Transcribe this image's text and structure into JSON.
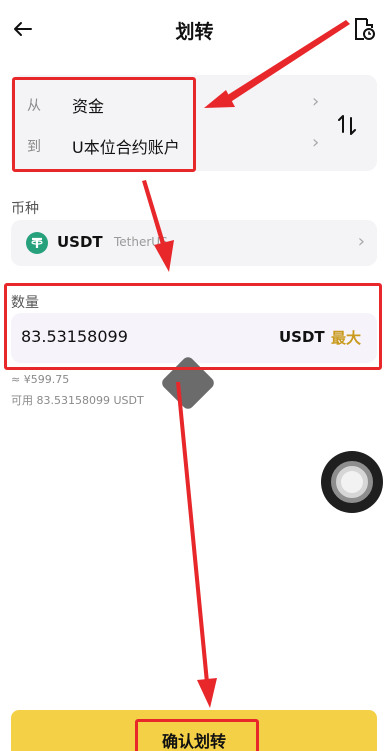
{
  "header": {
    "title": "划转",
    "back_icon": "arrow-left-icon",
    "history_icon": "history-document-icon"
  },
  "transfer": {
    "from_label": "从",
    "from_value": "资金",
    "to_label": "到",
    "to_value": "U本位合约账户",
    "swap_icon": "swap-arrows-icon"
  },
  "coin": {
    "section_label": "币种",
    "symbol": "USDT",
    "name": "TetherUS",
    "icon": "tether-icon"
  },
  "amount": {
    "section_label": "数量",
    "value": "83.53158099",
    "unit": "USDT",
    "max_label": "最大",
    "fiat_estimate": "≈ ¥599.75",
    "available": "可用 83.53158099 USDT"
  },
  "confirm": {
    "label": "确认划转"
  },
  "colors": {
    "accent_yellow": "#f3d046",
    "max_gold": "#c99a1d",
    "annotation_red": "#e8272b",
    "tether_green": "#27a17c"
  }
}
